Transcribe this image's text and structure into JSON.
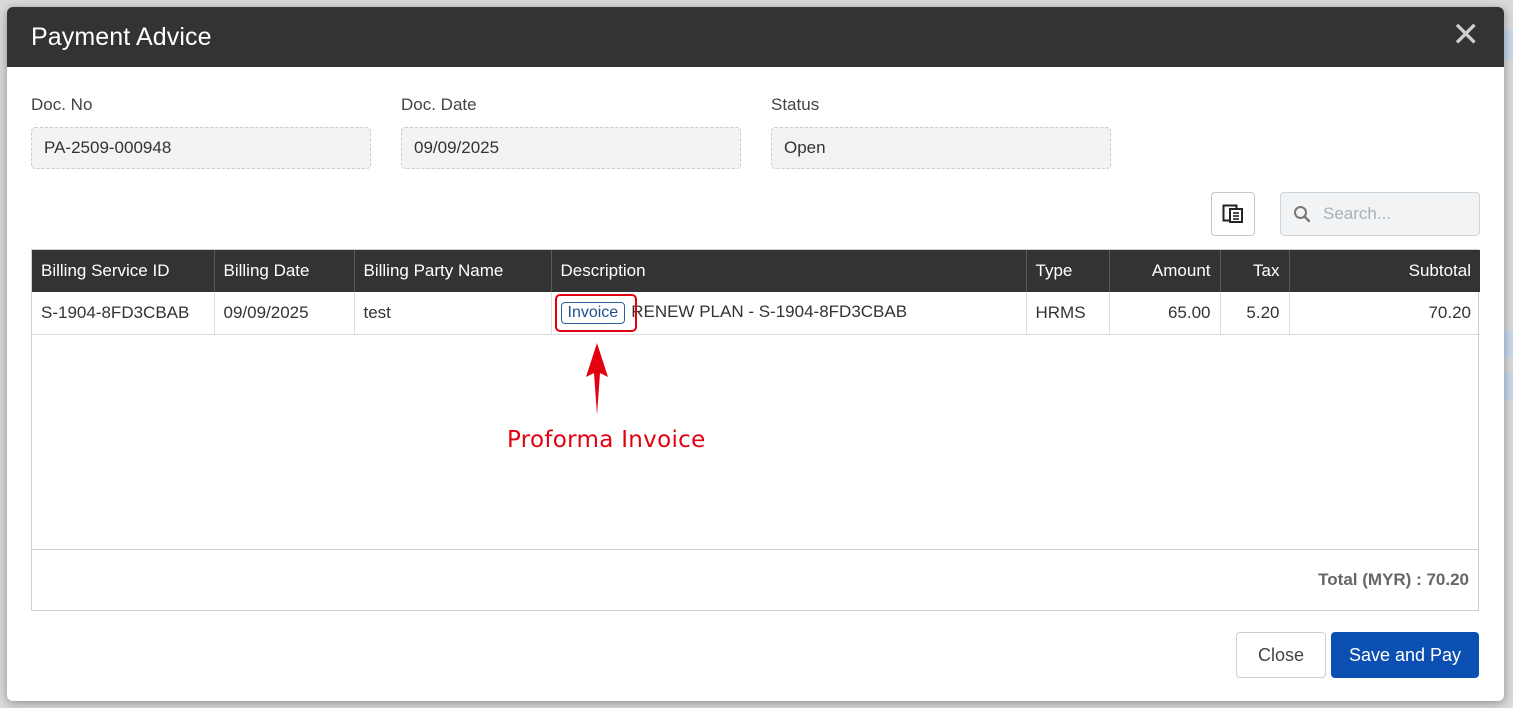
{
  "modal": {
    "title": "Payment Advice",
    "close_icon": "close-icon"
  },
  "fields": {
    "doc_no": {
      "label": "Doc. No",
      "value": "PA-2509-000948"
    },
    "doc_date": {
      "label": "Doc. Date",
      "value": "09/09/2025"
    },
    "status": {
      "label": "Status",
      "value": "Open"
    }
  },
  "toolbar": {
    "column_chooser_icon": "column-chooser-icon",
    "search_placeholder": "Search...",
    "search_icon": "search-icon"
  },
  "table": {
    "columns": [
      "Billing Service ID",
      "Billing Date",
      "Billing Party Name",
      "Description",
      "Type",
      "Amount",
      "Tax",
      "Subtotal"
    ],
    "rows": [
      {
        "billing_service_id": "S-1904-8FD3CBAB",
        "billing_date": "09/09/2025",
        "billing_party_name": "test",
        "invoice_link": "Invoice",
        "description": "RENEW PLAN - S-1904-8FD3CBAB",
        "type": "HRMS",
        "amount": "65.00",
        "tax": "5.20",
        "subtotal": "70.20"
      }
    ],
    "total": "Total (MYR) : 70.20"
  },
  "annotation": {
    "text": "Proforma Invoice",
    "color": "#e3000f"
  },
  "buttons": {
    "close": "Close",
    "save_and_pay": "Save and Pay"
  },
  "colors": {
    "header_bg": "#333333",
    "primary": "#0b4fb3"
  }
}
